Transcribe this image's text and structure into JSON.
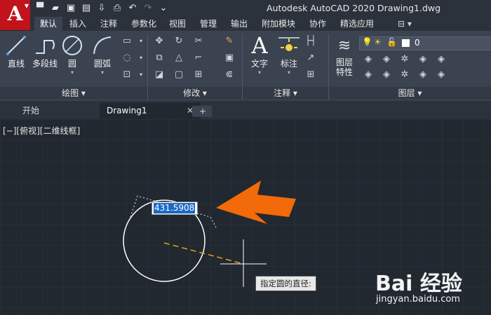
{
  "app": {
    "logo_letter": "A",
    "title": "Autodesk AutoCAD 2020    Drawing1.dwg"
  },
  "quick_access": {
    "icons": [
      "new-icon",
      "open-icon",
      "save-icon",
      "saveas-icon",
      "publish-icon",
      "print-icon",
      "undo-icon",
      "redo-icon",
      "qat-menu-icon"
    ]
  },
  "menu_tabs": [
    "默认",
    "插入",
    "注释",
    "参数化",
    "视图",
    "管理",
    "输出",
    "附加模块",
    "协作",
    "精选应用"
  ],
  "ribbon": {
    "draw": {
      "title": "绘图 ▾",
      "line": "直线",
      "polyline": "多段线",
      "circle": "圆",
      "arc": "圆弧"
    },
    "modify": {
      "title": "修改 ▾"
    },
    "annotation": {
      "title": "注释 ▾",
      "text": "文字",
      "dimension": "标注"
    },
    "layers": {
      "title": "图层 ▾",
      "layer_props": "图层\n特性",
      "current_layer": "0"
    }
  },
  "doc_tabs": {
    "start": "开始",
    "drawing": "Drawing1",
    "close": "✕",
    "add": "+"
  },
  "viewport": {
    "label": "[−][俯视][二维线框]"
  },
  "command": {
    "input_value": "431.5908",
    "prompt": "指定圆的直径:"
  },
  "watermark": {
    "logo": "Bai 经验",
    "url": "jingyan.baidu.com"
  },
  "colors": {
    "accent": "#c2121b",
    "arrow": "#f26a0a",
    "canvas_bg": "#212830",
    "highlight": "#1c69c5"
  }
}
